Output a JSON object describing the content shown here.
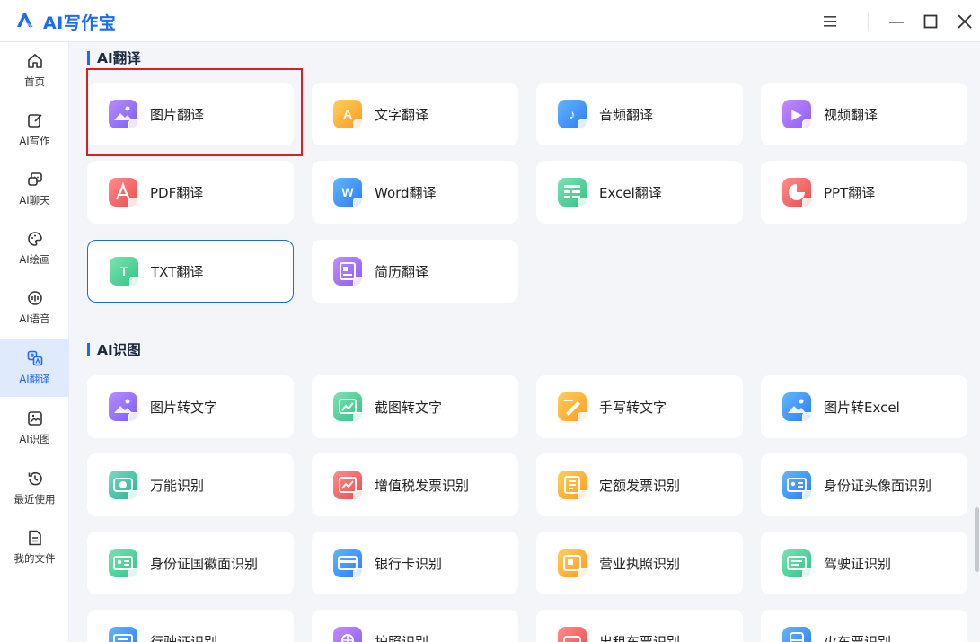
{
  "app": {
    "title": "AI写作宝"
  },
  "window_controls": [
    "menu-icon",
    "minimize-icon",
    "maximize-icon",
    "close-icon"
  ],
  "sidebar": {
    "items": [
      {
        "label": "首页",
        "icon": "home-icon",
        "active": false
      },
      {
        "label": "AI写作",
        "icon": "edit-icon",
        "active": false
      },
      {
        "label": "AI聊天",
        "icon": "chat-icon",
        "active": false
      },
      {
        "label": "AI绘画",
        "icon": "palette-icon",
        "active": false
      },
      {
        "label": "AI语音",
        "icon": "voice-icon",
        "active": false
      },
      {
        "label": "AI翻译",
        "icon": "translate-icon",
        "active": true
      },
      {
        "label": "AI识图",
        "icon": "image-recognize-icon",
        "active": false
      },
      {
        "label": "最近使用",
        "icon": "history-icon",
        "active": false
      },
      {
        "label": "我的文件",
        "icon": "file-icon",
        "active": false
      }
    ]
  },
  "sections": [
    {
      "title": "AI翻译",
      "cards": [
        {
          "label": "图片翻译",
          "icon": "image-icon",
          "color": "purple"
        },
        {
          "label": "文字翻译",
          "icon": "text-icon",
          "color": "orange"
        },
        {
          "label": "音频翻译",
          "icon": "audio-icon",
          "color": "blue"
        },
        {
          "label": "视频翻译",
          "icon": "video-icon",
          "color": "violet"
        },
        {
          "label": "PDF翻译",
          "icon": "pdf-icon",
          "color": "red"
        },
        {
          "label": "Word翻译",
          "icon": "word-icon",
          "color": "blue"
        },
        {
          "label": "Excel翻译",
          "icon": "excel-icon",
          "color": "green"
        },
        {
          "label": "PPT翻译",
          "icon": "ppt-icon",
          "color": "red"
        },
        {
          "label": "TXT翻译",
          "icon": "txt-icon",
          "color": "green",
          "selected": true
        },
        {
          "label": "简历翻译",
          "icon": "resume-icon",
          "color": "violet"
        }
      ]
    },
    {
      "title": "AI识图",
      "cards": [
        {
          "label": "图片转文字",
          "icon": "image-to-text-icon",
          "color": "purple"
        },
        {
          "label": "截图转文字",
          "icon": "screenshot-icon",
          "color": "green"
        },
        {
          "label": "手写转文字",
          "icon": "handwriting-icon",
          "color": "orange"
        },
        {
          "label": "图片转Excel",
          "icon": "image-to-excel-icon",
          "color": "blue"
        },
        {
          "label": "万能识别",
          "icon": "universal-recognize-icon",
          "color": "cyan"
        },
        {
          "label": "增值税发票识别",
          "icon": "vat-invoice-icon",
          "color": "red"
        },
        {
          "label": "定额发票识别",
          "icon": "quota-invoice-icon",
          "color": "orange"
        },
        {
          "label": "身份证头像面识别",
          "icon": "id-card-front-icon",
          "color": "blue"
        },
        {
          "label": "身份证国徽面识别",
          "icon": "id-card-back-icon",
          "color": "green"
        },
        {
          "label": "银行卡识别",
          "icon": "bank-card-icon",
          "color": "blue"
        },
        {
          "label": "营业执照识别",
          "icon": "business-license-icon",
          "color": "orange"
        },
        {
          "label": "驾驶证识别",
          "icon": "driver-license-icon",
          "color": "green"
        },
        {
          "label": "行驶证识别",
          "icon": "vehicle-license-icon",
          "color": "blue"
        },
        {
          "label": "护照识别",
          "icon": "passport-icon",
          "color": "violet"
        },
        {
          "label": "出租车票识别",
          "icon": "taxi-ticket-icon",
          "color": "red"
        },
        {
          "label": "火车票识别",
          "icon": "train-ticket-icon",
          "color": "blue"
        }
      ]
    }
  ],
  "colors": {
    "accent": "#1f6bef",
    "highlight": "#d42020",
    "selected_border": "#1b6cd8"
  }
}
